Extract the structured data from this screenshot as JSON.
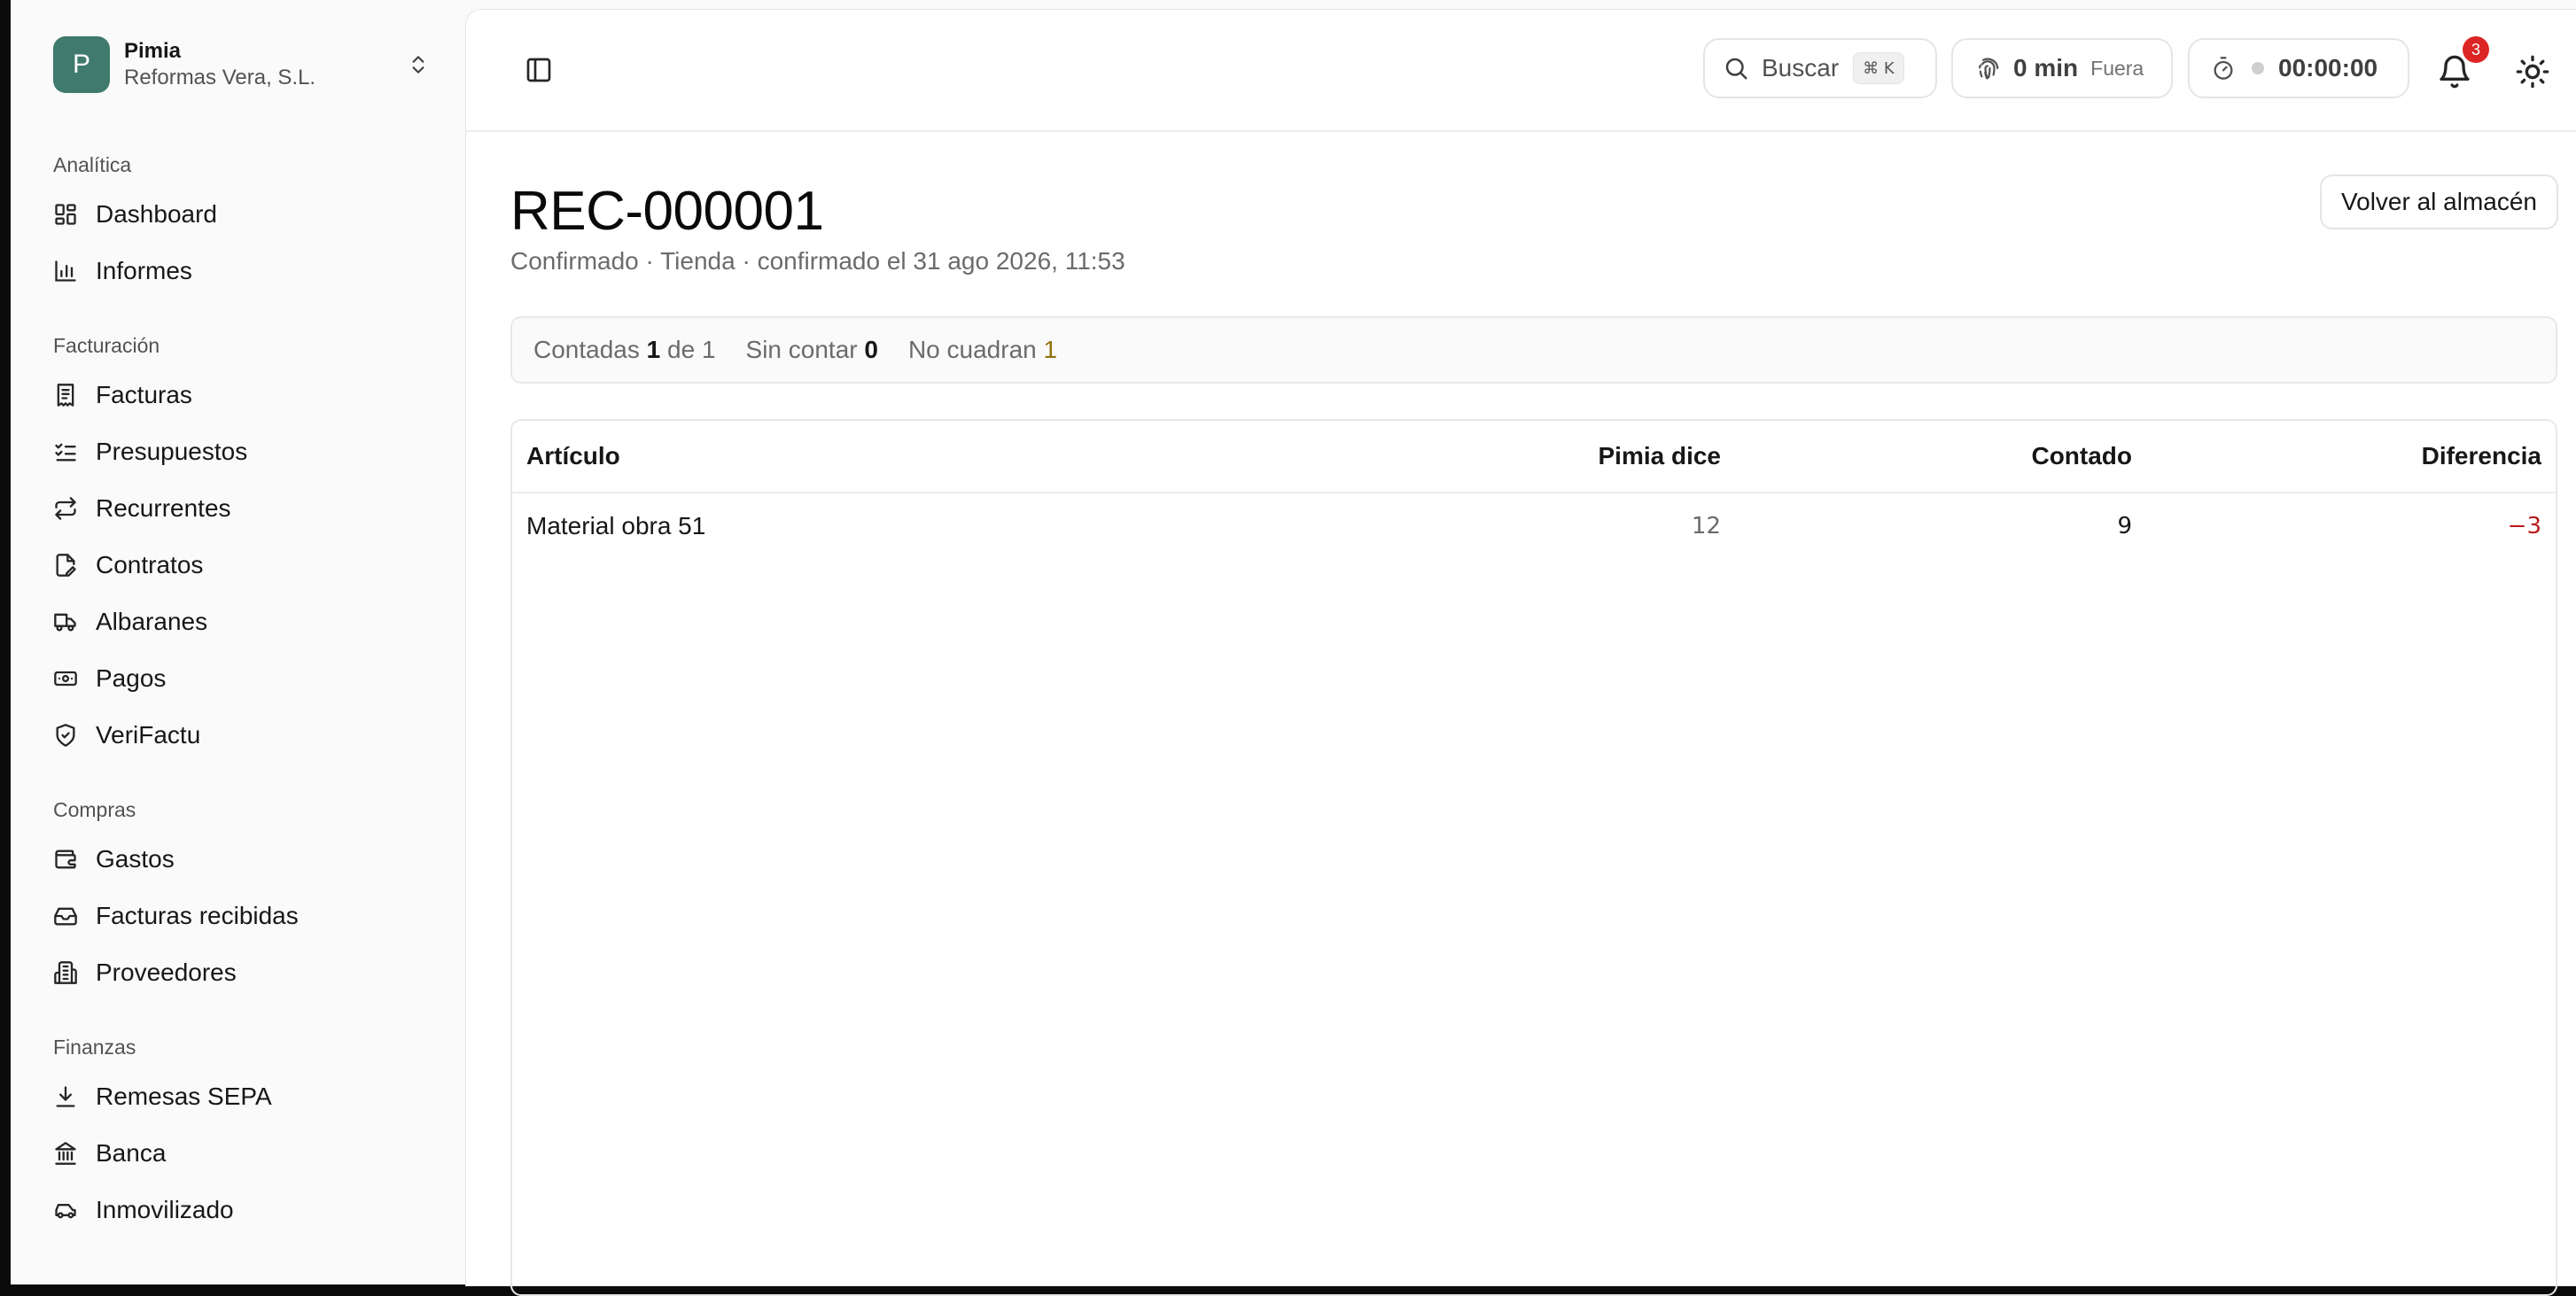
{
  "org": {
    "initial": "P",
    "name": "Pimia",
    "company": "Reformas Vera, S.L."
  },
  "nav": {
    "groups": [
      {
        "label": "Analítica",
        "items": [
          {
            "label": "Dashboard"
          },
          {
            "label": "Informes"
          }
        ]
      },
      {
        "label": "Facturación",
        "items": [
          {
            "label": "Facturas"
          },
          {
            "label": "Presupuestos"
          },
          {
            "label": "Recurrentes"
          },
          {
            "label": "Contratos"
          },
          {
            "label": "Albaranes"
          },
          {
            "label": "Pagos"
          },
          {
            "label": "VeriFactu"
          }
        ]
      },
      {
        "label": "Compras",
        "items": [
          {
            "label": "Gastos"
          },
          {
            "label": "Facturas recibidas"
          },
          {
            "label": "Proveedores"
          }
        ]
      },
      {
        "label": "Finanzas",
        "items": [
          {
            "label": "Remesas SEPA"
          },
          {
            "label": "Banca"
          },
          {
            "label": "Inmovilizado"
          }
        ]
      }
    ]
  },
  "topbar": {
    "search_label": "Buscar",
    "search_shortcut": "⌘ K",
    "time_value": "0 min",
    "time_state": "Fuera",
    "timer_value": "00:00:00",
    "notifications_count": "3"
  },
  "page": {
    "title": "REC-000001",
    "subtitle": "Confirmado · Tienda · confirmado el 31 ago 2026, 11:53",
    "back_label": "Volver al almacén"
  },
  "stats": {
    "counted_label": "Contadas",
    "counted_value": "1",
    "counted_of": "de 1",
    "uncounted_label": "Sin contar",
    "uncounted_value": "0",
    "mismatch_label": "No cuadran",
    "mismatch_value": "1"
  },
  "table": {
    "columns": [
      "Artículo",
      "Pimia dice",
      "Contado",
      "Diferencia"
    ],
    "rows": [
      {
        "article": "Material obra 51",
        "system": "12",
        "counted": "9",
        "diff": "−3"
      }
    ]
  },
  "colors": {
    "accent": "#3f7a6d",
    "danger": "#b91c1c",
    "warning": "#92700a",
    "badge": "#dc2626"
  }
}
